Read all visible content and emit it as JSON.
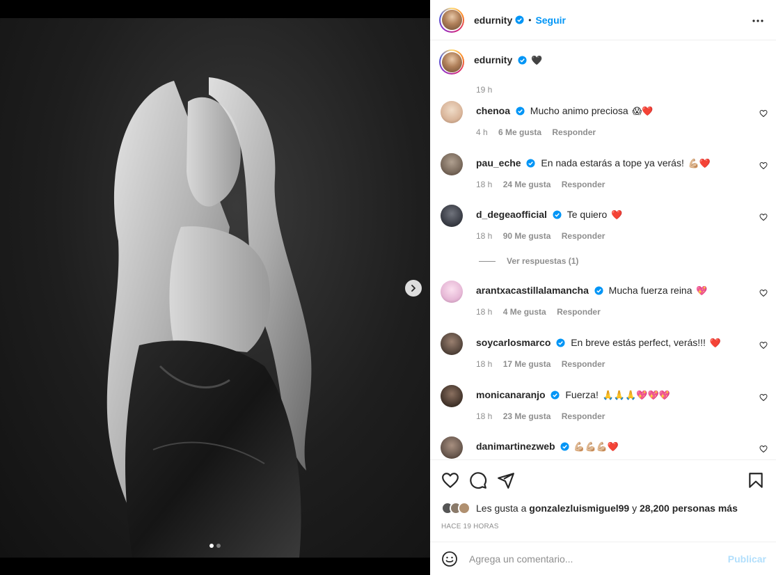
{
  "header": {
    "username": "edurnity",
    "bullet": "•",
    "follow_label": "Seguir",
    "more_icon": "more-horizontal-icon"
  },
  "caption": {
    "username": "edurnity",
    "emoji": "🖤",
    "time": "19 h"
  },
  "comments": [
    {
      "user": "chenoa",
      "text": "Mucho animo preciosa",
      "emoji": "😱❤️",
      "time": "4 h",
      "likes": "6 Me gusta",
      "reply": "Responder",
      "avatar": "#d9b59a"
    },
    {
      "user": "pau_eche",
      "text": "En nada estarás a tope ya verás!",
      "emoji": "💪🏼❤️",
      "time": "18 h",
      "likes": "24 Me gusta",
      "reply": "Responder",
      "avatar": "#7a6a5c"
    },
    {
      "user": "d_degeaofficial",
      "text": "Te quiero",
      "emoji": "❤️",
      "time": "18 h",
      "likes": "90 Me gusta",
      "reply": "Responder",
      "avatar": "#3c3f48"
    },
    {
      "user": "arantxacastillalamancha",
      "text": "Mucha fuerza reina",
      "emoji": "💖",
      "time": "18 h",
      "likes": "4 Me gusta",
      "reply": "Responder",
      "avatar": "#e6b8d6"
    },
    {
      "user": "soycarlosmarco",
      "text": "En breve estás perfect, verás!!!",
      "emoji": "❤️",
      "time": "18 h",
      "likes": "17 Me gusta",
      "reply": "Responder",
      "avatar": "#5a4a40"
    },
    {
      "user": "monicanaranjo",
      "text": "Fuerza!",
      "emoji": "🙏🙏🙏💖💖💖",
      "time": "18 h",
      "likes": "23 Me gusta",
      "reply": "Responder",
      "avatar": "#4a3a30"
    },
    {
      "user": "danimartinezweb",
      "text": "",
      "emoji": "💪🏼💪🏼💪🏼❤️",
      "time": "",
      "likes": "",
      "reply": "",
      "avatar": "#6b5a50"
    }
  ],
  "view_replies": "Ver respuestas (1)",
  "likes": {
    "prefix": "Les gusta a",
    "user": "gonzalezluismiguel99",
    "middle": "y",
    "count": "28,200 personas más"
  },
  "posted": "HACE 19 HORAS",
  "add_comment": {
    "placeholder": "Agrega un comentario...",
    "publish": "Publicar"
  },
  "carousel": {
    "current": 1,
    "total": 2
  },
  "colors": {
    "accent": "#0095f6",
    "text": "#262626",
    "muted": "#8e8e8e",
    "publish_disabled": "#b2dffc"
  }
}
